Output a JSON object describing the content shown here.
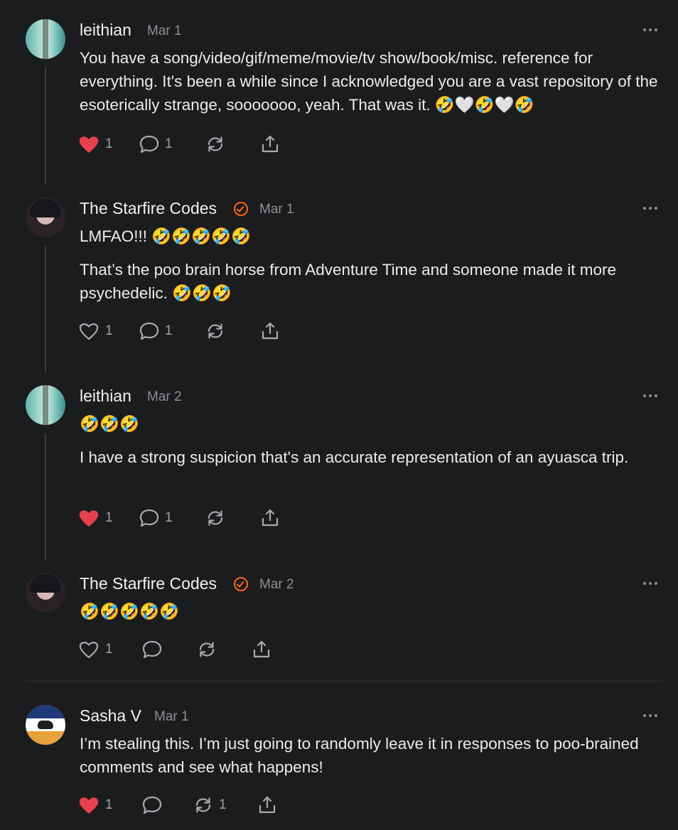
{
  "comments": [
    {
      "author": "leithian",
      "date": "Mar 1",
      "paragraphs": [
        "You have a song/video/gif/meme/movie/tv show/book/misc. reference for everything. It's been a while since I acknowledged you are a vast repository of the esoterically strange, sooooooo, yeah. That was it. 🤣🤍🤣🤍🤣"
      ],
      "likes": "1",
      "liked": true,
      "replies": "1",
      "restacks": ""
    },
    {
      "author": "The Starfire Codes",
      "date": "Mar 1",
      "paragraphs": [
        "LMFAO!!! 🤣🤣🤣🤣🤣",
        "That’s the poo brain horse from Adventure Time and someone made it more psychedelic. 🤣🤣🤣"
      ],
      "likes": "1",
      "liked": false,
      "replies": "1",
      "restacks": ""
    },
    {
      "author": "leithian",
      "date": "Mar 2",
      "paragraphs": [
        "🤣🤣🤣",
        "I have a strong suspicion that's an accurate representation of an ayuasca trip."
      ],
      "likes": "1",
      "liked": true,
      "replies": "1",
      "restacks": ""
    },
    {
      "author": "The Starfire Codes",
      "date": "Mar 2",
      "paragraphs": [
        "🤣🤣🤣🤣🤣"
      ],
      "likes": "1",
      "liked": false,
      "replies": "",
      "restacks": ""
    },
    {
      "author": "Sasha V",
      "date": "Mar 1",
      "paragraphs": [
        "I’m stealing this. I’m just going to randomly leave it in responses to poo-brained comments and see what happens!"
      ],
      "likes": "1",
      "liked": true,
      "replies": "",
      "restacks": "1"
    }
  ],
  "icons": {
    "like": "heart-icon",
    "reply": "comment-bubble-icon",
    "restack": "restack-icon",
    "share": "share-icon",
    "more": "more-options-icon",
    "verified": "verified-badge-icon"
  },
  "colors": {
    "background": "#1b1c1e",
    "liked_heart": "#e8414e",
    "badge": "#ff6719",
    "muted": "#8d8e92"
  }
}
